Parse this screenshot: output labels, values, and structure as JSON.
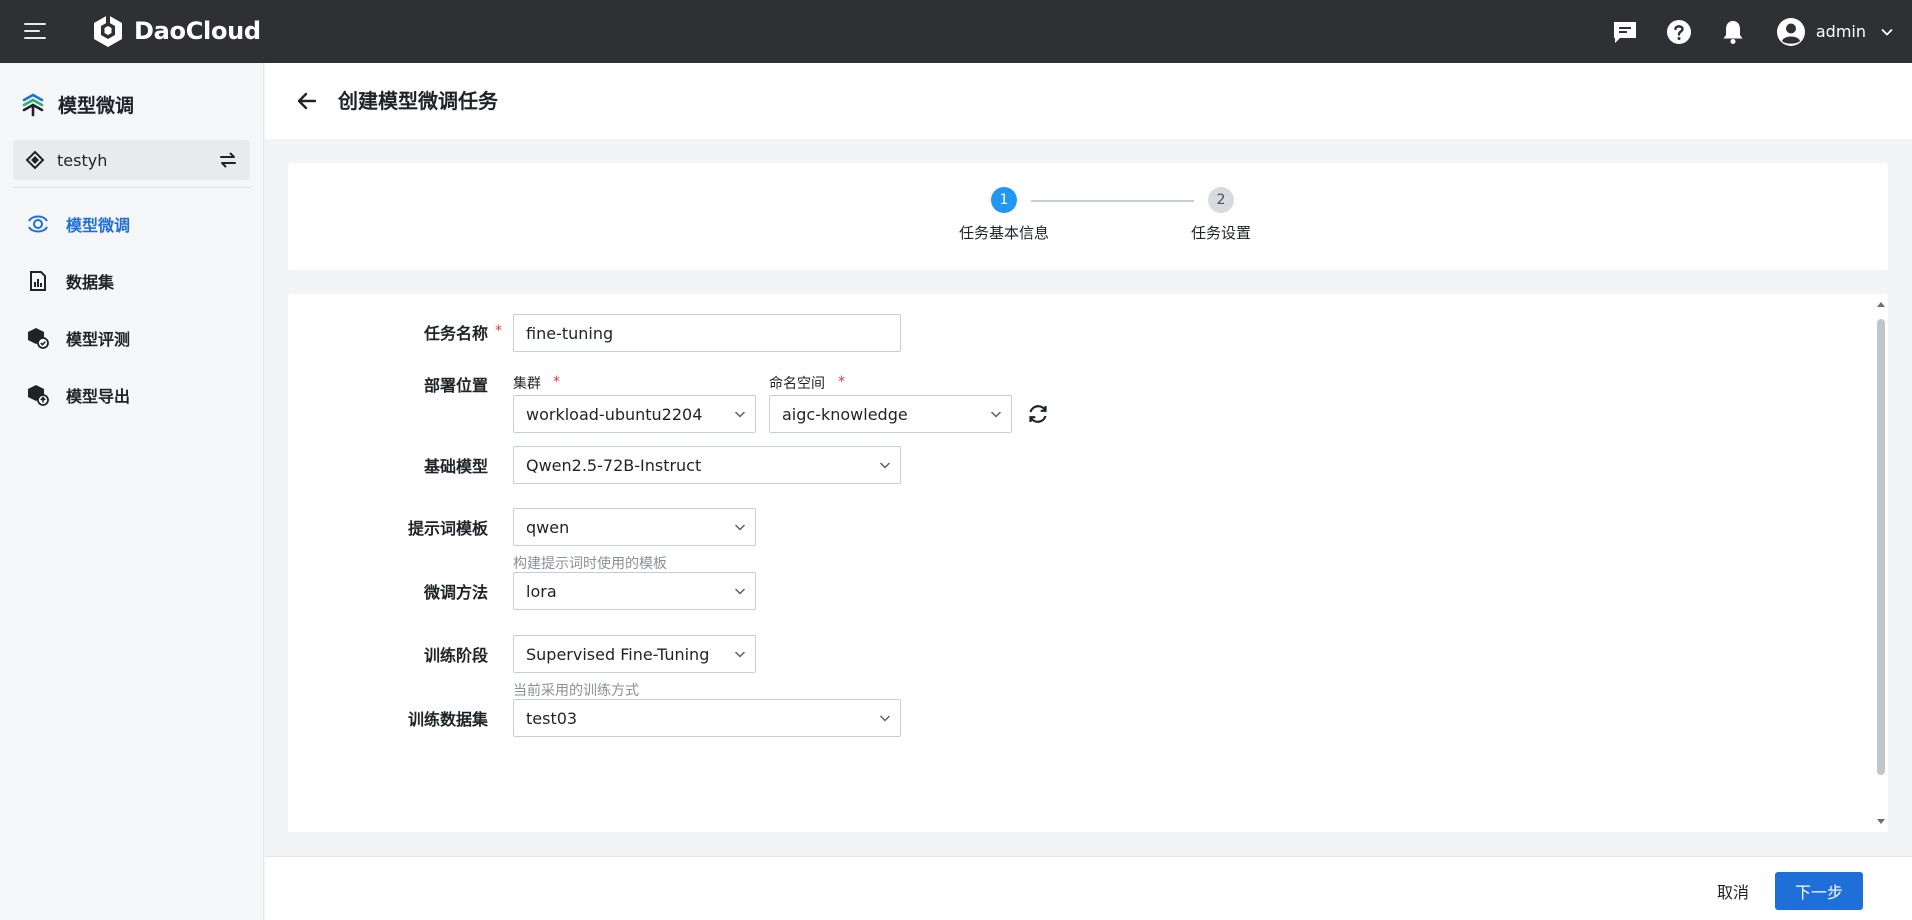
{
  "topbar": {
    "brand": "DaoCloud",
    "icons": [
      "menu-icon",
      "message-icon",
      "help-icon",
      "bell-icon",
      "user-avatar-icon",
      "chevron-down-icon"
    ],
    "user_name": "admin"
  },
  "sidebar": {
    "title": "模型微调",
    "workspace": "testyh",
    "items": [
      {
        "label": "模型微调",
        "icon": "finetune-icon",
        "active": true
      },
      {
        "label": "数据集",
        "icon": "dataset-icon",
        "active": false
      },
      {
        "label": "模型评测",
        "icon": "evaluate-icon",
        "active": false
      },
      {
        "label": "模型导出",
        "icon": "export-icon",
        "active": false
      }
    ]
  },
  "header": {
    "title": "创建模型微调任务"
  },
  "steps": [
    {
      "number": "1",
      "label": "任务基本信息",
      "active": true
    },
    {
      "number": "2",
      "label": "任务设置",
      "active": false
    }
  ],
  "form": {
    "task_name": {
      "label": "任务名称",
      "value": "fine-tuning"
    },
    "deploy": {
      "label": "部署位置",
      "cluster_label": "集群",
      "cluster_value": "workload-ubuntu2204",
      "namespace_label": "命名空间",
      "namespace_value": "aigc-knowledge"
    },
    "base_model": {
      "label": "基础模型",
      "value": "Qwen2.5-72B-Instruct"
    },
    "prompt_template": {
      "label": "提示词模板",
      "value": "qwen",
      "hint": "构建提示词时使用的模板"
    },
    "finetune_method": {
      "label": "微调方法",
      "value": "lora"
    },
    "train_stage": {
      "label": "训练阶段",
      "value": "Supervised Fine-Tuning",
      "hint": "当前采用的训练方式"
    },
    "train_dataset": {
      "label": "训练数据集",
      "value": "test03"
    }
  },
  "footer": {
    "cancel_label": "取消",
    "next_label": "下一步"
  },
  "colors": {
    "topbar": "#2e3034",
    "accent": "#1f6fd8",
    "step_active": "#2196f3",
    "required": "#e5373c"
  }
}
